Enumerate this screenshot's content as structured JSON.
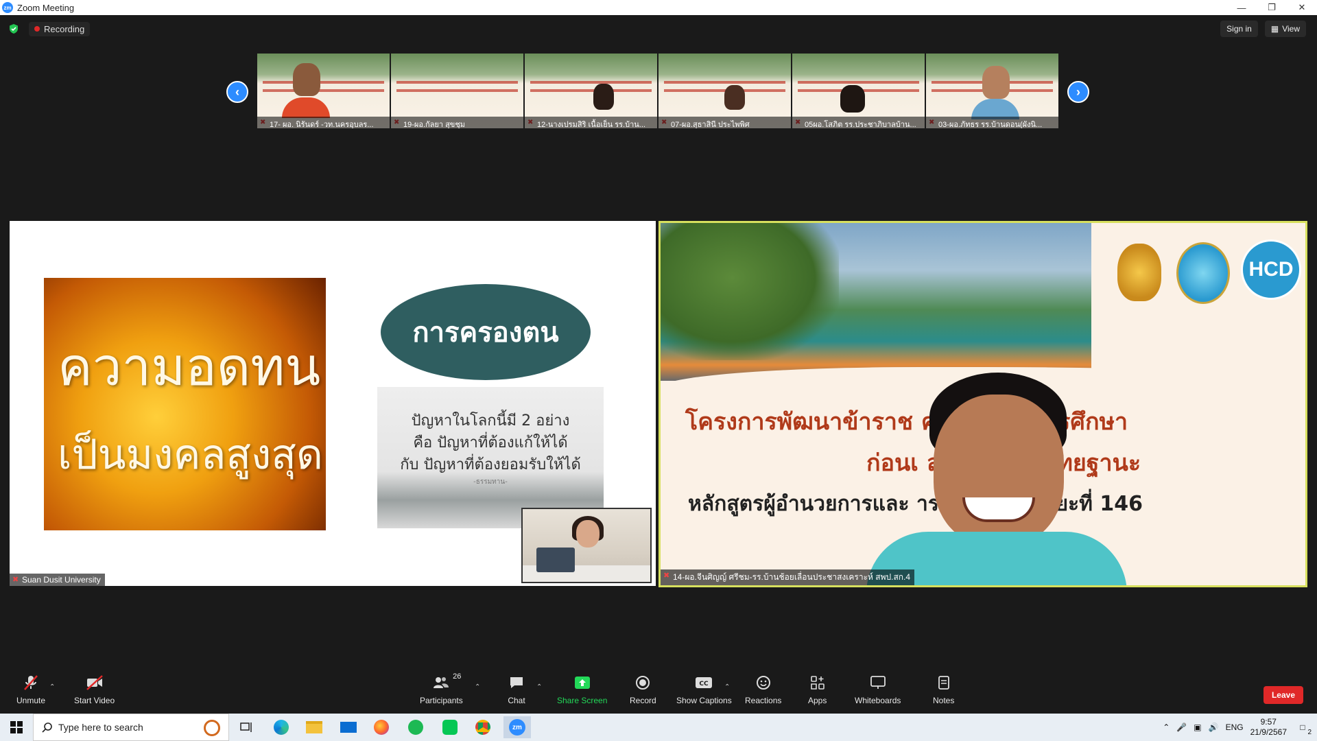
{
  "window": {
    "title": "Zoom Meeting",
    "logo_text": "zm",
    "controls": [
      "minimize",
      "restore",
      "close"
    ]
  },
  "topbar": {
    "recording_label": "Recording",
    "sign_in_label": "Sign in",
    "view_label": "View"
  },
  "thumbnails": [
    {
      "name": "17- ผอ. นิรันดร์ -วท.นครอุบลร..."
    },
    {
      "name": "19-ผอ.กัลยา สุขชุม"
    },
    {
      "name": "12-นางเปรมสิริ เนื้อเย็น รร.บ้าน..."
    },
    {
      "name": "07-ผอ.สุธาสินี ประไพพิศ"
    },
    {
      "name": "05ผอ.โสภิต รร.ประชาภิบาลบ้าน..."
    },
    {
      "name": "03-ผอ.ภัทธร รร.บ้านดอน(ผังนิ..."
    }
  ],
  "main_stage": {
    "left": {
      "slide_title_line1": "ความอดทน",
      "slide_title_line2": "เป็นมงคลสูงสุด",
      "oval_text": "การครองตน",
      "quote_line1": "ปัญหาในโลกนี้มี 2 อย่าง",
      "quote_line2": "คือ ปัญหาที่ต้องแก้ให้ได้",
      "quote_line3": "กับ ปัญหาที่ต้องยอมรับให้ได้",
      "quote_source": "-ธรรมทาน-",
      "participant_label": "Suan Dusit University"
    },
    "right": {
      "banner_line1": "โครงการพัฒนาข้าราช    คลากรทางการศึกษา",
      "banner_line2": "ก่อนเ          ละเลื่อนเป็นวิทยฐานะ",
      "banner_line3": "หลักสูตรผู้อำนวยการและ          ารเชี่ยวชาญ ระยะที่ 146",
      "logo_text": "HCD",
      "participant_label": "14-ผอ.จีนศิญญ์ ศรีชม-รร.บ้านช้อยเลื่อนประชาสงเคราะห์ สพป.สก.4"
    }
  },
  "toolbar": {
    "unmute": "Unmute",
    "start_video": "Start Video",
    "participants": "Participants",
    "participants_count": "26",
    "chat": "Chat",
    "share_screen": "Share Screen",
    "record": "Record",
    "show_captions": "Show Captions",
    "reactions": "Reactions",
    "apps": "Apps",
    "whiteboards": "Whiteboards",
    "notes": "Notes",
    "leave": "Leave",
    "accent_green": "#23d959",
    "leave_red": "#e02828"
  },
  "taskbar": {
    "search_placeholder": "Type here to search",
    "language": "ENG",
    "time": "9:57",
    "date": "21/9/2567",
    "notification_count": "2"
  }
}
